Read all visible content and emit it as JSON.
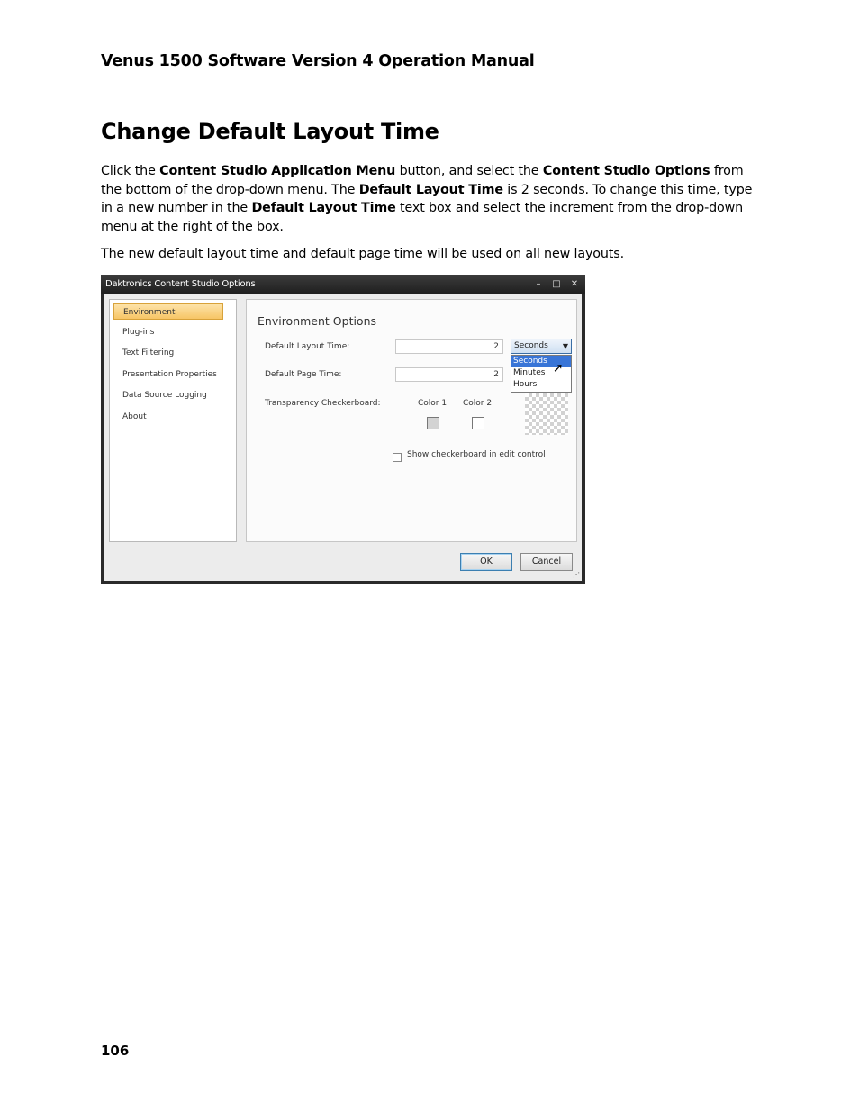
{
  "header": {
    "title": "Venus 1500 Software Version 4 Operation Manual"
  },
  "section": {
    "title": "Change Default Layout Time",
    "para1": [
      {
        "text": "Click the ",
        "bold": false
      },
      {
        "text": "Content Studio Application Menu",
        "bold": true
      },
      {
        "text": " button, and select the ",
        "bold": false
      },
      {
        "text": "Content Studio Options",
        "bold": true
      },
      {
        "text": " from the bottom of the drop-down menu. The ",
        "bold": false
      },
      {
        "text": "Default Layout Time",
        "bold": true
      },
      {
        "text": " is 2 seconds. To change this time, type in a new number in the ",
        "bold": false
      },
      {
        "text": "Default Layout Time",
        "bold": true
      },
      {
        "text": " text box and select the increment from the drop-down menu at the right of the box.",
        "bold": false
      }
    ],
    "para2": "The new default layout time and default page time will be used on all new layouts."
  },
  "dialog": {
    "title": "Daktronics Content Studio Options",
    "window_buttons": {
      "minimize": "–",
      "maximize": "□",
      "close": "✕"
    },
    "nav_items": [
      {
        "label": "Environment",
        "selected": true
      },
      {
        "label": "Plug-ins",
        "selected": false
      },
      {
        "label": "Text Filtering",
        "selected": false
      },
      {
        "label": "Presentation Properties",
        "selected": false
      },
      {
        "label": "Data Source Logging",
        "selected": false
      },
      {
        "label": "About",
        "selected": false
      }
    ],
    "env_title": "Environment Options",
    "layout_time_label": "Default Layout Time:",
    "layout_time_value": "2",
    "page_time_label": "Default Page Time:",
    "page_time_value": "2",
    "unit_selected": "Seconds",
    "unit_options": [
      "Seconds",
      "Minutes",
      "Hours"
    ],
    "checkerboard_label": "Transparency Checkerboard:",
    "color1_label": "Color 1",
    "color2_label": "Color 2",
    "show_checkerboard_label": "Show checkerboard in edit control",
    "show_checkerboard_checked": false,
    "ok_label": "OK",
    "cancel_label": "Cancel",
    "colors": {
      "selection": "#3875d7",
      "nav_highlight": "#f7c566"
    }
  },
  "footer": {
    "page_number": "106"
  }
}
